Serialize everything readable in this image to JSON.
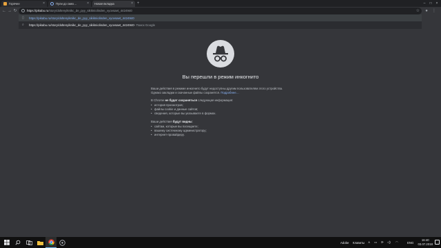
{
  "tabs": [
    {
      "title": "Горячее",
      "favicon_color": "#e8a33d",
      "active": false
    },
    {
      "title": "Пули до смех…",
      "favicon_color": "#8ab4f8",
      "active": false
    },
    {
      "title": "Новая вкладка",
      "favicon_color": "",
      "active": true
    }
  ],
  "omnibox": {
    "host": "https://pikabu.ru",
    "path": "/story/doltenyiknikc_de_pyy_sikikniolinden_vyovsaet_4424940"
  },
  "suggestions": [
    {
      "url": "https://pikabu.ru/story/doltenyiknikc_de_pyy_sikikniolinden_vyovsaet_4424940",
      "hint": ""
    },
    {
      "url": "https://pikabu.ru/story/doltenyiknikc_de_pyy_sikikniolinden_vyovsaet_4424940",
      "hint": " - Поиск Google"
    }
  ],
  "page": {
    "title": "Вы перешли в режим инкогнито",
    "intro": "Ваши действия в режиме инкогнито будут недоступны другим пользователям этого устройства. Однако закладки и скачанные файлы сохранятся. ",
    "intro_link": "Подробнее…",
    "not_saved_pre": "В Chrome ",
    "not_saved_bold": "не будет сохраняться",
    "not_saved_post": " следующая информация:",
    "not_saved_items": [
      "история просмотров;",
      "файлы cookie и данные сайтов;",
      "сведения, которые вы указываете в формах."
    ],
    "visible_pre": "Ваши действия ",
    "visible_bold": "будут видны",
    "visible_post": ":",
    "visible_items": [
      "сайтам, которые вы посещаете;",
      "вашему системному администратору;",
      "интернет-провайдеру."
    ]
  },
  "taskbar": {
    "tray_user": "Adobe",
    "tray_keyboard": "Клавиты",
    "language": "ENG",
    "time": "16:40",
    "date": "03.07.2018"
  },
  "colors": {
    "background": "#35363a",
    "link": "#8ab4f8",
    "taskbar": "#101010"
  }
}
